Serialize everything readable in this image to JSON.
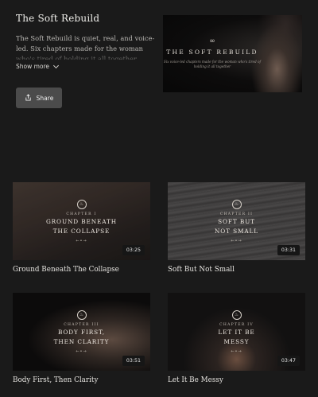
{
  "header": {
    "title": "The Soft Rebuild",
    "description": "The Soft Rebuild is quiet, real, and voice-led. Six chapters made for the woman who's tired of holding it all together.",
    "show_more_label": "Show more",
    "share_label": "Share"
  },
  "cover": {
    "symbol": "∞",
    "title": "THE SOFT REBUILD",
    "subtitle": "Six voice-led chapters made for the woman who's tired of holding it all together"
  },
  "videos": [
    {
      "chapter": "CHAPTER I",
      "thumb_title_1": "GROUND BENEATH",
      "thumb_title_2": "THE COLLAPSE",
      "duration": "03:25",
      "title": "Ground Beneath The Collapse"
    },
    {
      "chapter": "CHAPTER II",
      "thumb_title_1": "SOFT BUT",
      "thumb_title_2": "NOT SMALL",
      "duration": "03:31",
      "title": "Soft But Not Small"
    },
    {
      "chapter": "CHAPTER III",
      "thumb_title_1": "BODY FIRST,",
      "thumb_title_2": "THEN CLARITY",
      "duration": "03:51",
      "title": "Body First, Then Clarity"
    },
    {
      "chapter": "CHAPTER IV",
      "thumb_title_1": "LET IT BE",
      "thumb_title_2": "MESSY",
      "duration": "03:47",
      "title": "Let It Be Messy"
    }
  ],
  "icons": {
    "share": "share-icon",
    "chevron": "chevron-down-icon",
    "emblem": "flame-emblem-icon"
  }
}
